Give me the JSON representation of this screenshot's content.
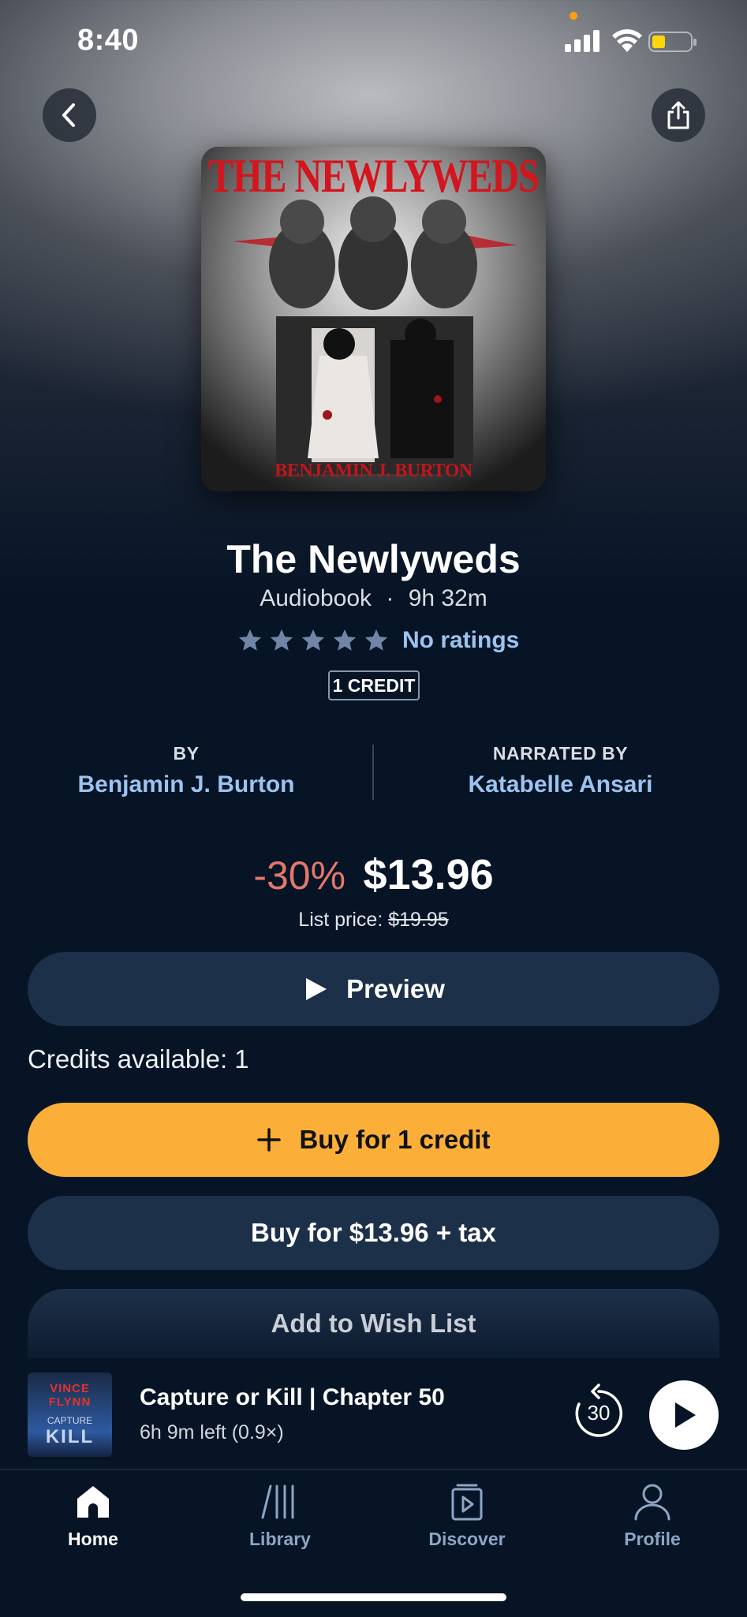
{
  "status_bar": {
    "time": "8:40"
  },
  "book": {
    "cover_title": "THE NEWLYWEDS",
    "cover_author": "BENJAMIN J. BURTON",
    "title": "The Newlyweds",
    "format": "Audiobook",
    "separator": "·",
    "duration": "9h 32m",
    "rating_stars": 5,
    "rating_text": "No ratings",
    "credit_badge": "1 CREDIT",
    "by_label": "BY",
    "author": "Benjamin J. Burton",
    "narrated_label": "NARRATED BY",
    "narrator": "Katabelle Ansari"
  },
  "pricing": {
    "discount": "-30%",
    "price": "$13.96",
    "list_price_label": "List price:",
    "list_price": "$19.95"
  },
  "actions": {
    "preview": "Preview",
    "credits_available": "Credits available: 1",
    "buy_credit": "Buy for 1 credit",
    "buy_price": "Buy for $13.96 + tax",
    "wishlist": "Add to Wish List"
  },
  "mini_player": {
    "cover_line1": "VINCE",
    "cover_line2": "FLYNN",
    "cover_line3": "CAPTURE",
    "cover_line4": "KILL",
    "title": "Capture or Kill | Chapter 50",
    "subtitle": "6h 9m left (0.9×)",
    "skip_seconds": "30"
  },
  "tabs": [
    {
      "label": "Home",
      "icon": "home-icon",
      "active": true
    },
    {
      "label": "Library",
      "icon": "library-icon",
      "active": false
    },
    {
      "label": "Discover",
      "icon": "discover-icon",
      "active": false
    },
    {
      "label": "Profile",
      "icon": "profile-icon",
      "active": false
    }
  ],
  "colors": {
    "accent_yellow": "#fcaf38",
    "button_dark": "#1d3049",
    "link_blue": "#9cc4f0",
    "discount_red": "#e2786b",
    "background": "#061426"
  }
}
